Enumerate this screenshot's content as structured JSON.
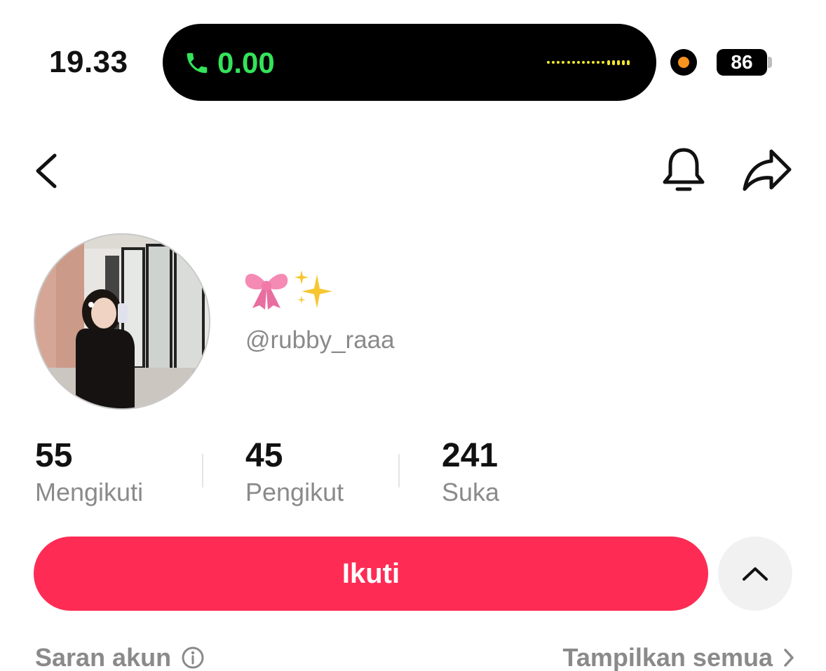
{
  "status_bar": {
    "time": "19.33",
    "call_duration": "0.00",
    "battery_level": "86",
    "call_color": "#34e35a",
    "recording_indicator_color": "#f7931e"
  },
  "nav": {
    "back_icon": "chevron-left-icon",
    "notification_icon": "bell-icon",
    "share_icon": "share-arrow-icon"
  },
  "profile": {
    "display_name": "🎀✨",
    "username": "@rubby_raaa"
  },
  "stats": [
    {
      "value": "55",
      "label": "Mengikuti"
    },
    {
      "value": "45",
      "label": "Pengikut"
    },
    {
      "value": "241",
      "label": "Suka"
    }
  ],
  "actions": {
    "follow_label": "Ikuti",
    "follow_color": "#fe2c55",
    "toggle_icon": "chevron-up-icon"
  },
  "suggestions": {
    "title": "Saran akun",
    "show_all": "Tampilkan semua"
  }
}
